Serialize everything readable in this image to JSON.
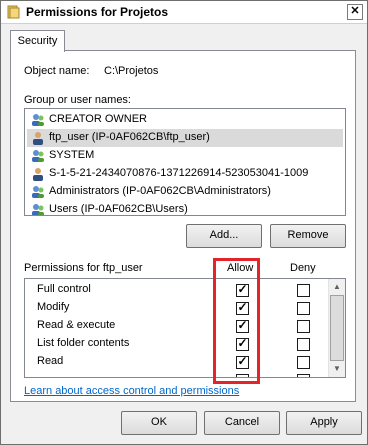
{
  "window": {
    "title": "Permissions for Projetos",
    "close_label": "✕"
  },
  "tab": {
    "label": "Security"
  },
  "object": {
    "label": "Object name:",
    "value": "C:\\Projetos"
  },
  "groups": {
    "label": "Group or user names:",
    "items": [
      {
        "label": "CREATOR OWNER",
        "icon": "group-icon"
      },
      {
        "label": "ftp_user (IP-0AF062CB\\ftp_user)",
        "icon": "user-icon"
      },
      {
        "label": "SYSTEM",
        "icon": "group-icon"
      },
      {
        "label": "S-1-5-21-2434070876-1371226914-523053041-1009",
        "icon": "user-icon"
      },
      {
        "label": "Administrators (IP-0AF062CB\\Administrators)",
        "icon": "group-icon"
      },
      {
        "label": "Users (IP-0AF062CB\\Users)",
        "icon": "group-icon"
      }
    ]
  },
  "buttons": {
    "add": "Add...",
    "remove": "Remove",
    "ok": "OK",
    "cancel": "Cancel",
    "apply": "Apply"
  },
  "permissions": {
    "label": "Permissions for ftp_user",
    "allow_header": "Allow",
    "deny_header": "Deny",
    "rows": [
      {
        "name": "Full control",
        "allow": true,
        "deny": false
      },
      {
        "name": "Modify",
        "allow": true,
        "deny": false
      },
      {
        "name": "Read & execute",
        "allow": true,
        "deny": false
      },
      {
        "name": "List folder contents",
        "allow": true,
        "deny": false
      },
      {
        "name": "Read",
        "allow": true,
        "deny": false
      }
    ]
  },
  "link": {
    "label": "Learn about access control and permissions"
  },
  "colors": {
    "highlight": "#e3242b",
    "selection": "#dadada",
    "link": "#0066cc"
  }
}
